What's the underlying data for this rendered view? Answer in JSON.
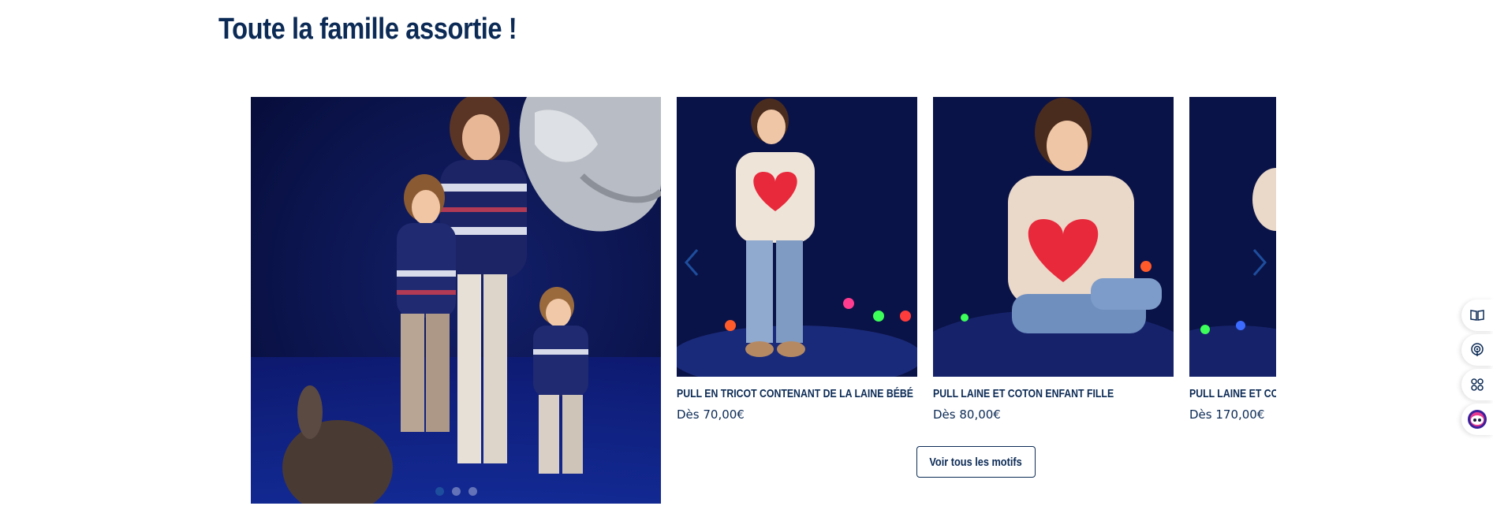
{
  "section": {
    "title": "Toute la famille assortie !"
  },
  "hero": {
    "dots": 3,
    "active_dot": 0
  },
  "carousel": {
    "products": [
      {
        "name": "PULL EN TRICOT CONTENANT DE LA LAINE BÉBÉ",
        "price": "Dès 70,00€"
      },
      {
        "name": "PULL LAINE ET COTON ENFANT FILLE",
        "price": "Dès 80,00€"
      },
      {
        "name": "PULL LAINE ET COTON ADULTE",
        "price": "Dès 170,00€"
      }
    ]
  },
  "cta": {
    "label": "Voir tous les motifs"
  },
  "tools": [
    "book-icon",
    "podcast-icon",
    "apps-icon",
    "chat-bot-icon"
  ],
  "colors": {
    "brand": "#0b2a55",
    "background": "#ffffff",
    "photo_bg": "#0a1250",
    "heart": "#e8283b"
  }
}
